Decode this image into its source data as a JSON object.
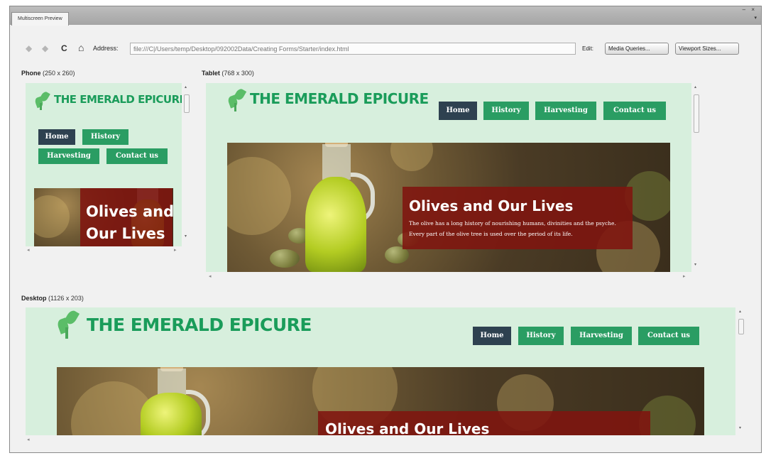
{
  "window": {
    "tab_title": "Multiscreen Preview",
    "controls": "– ×",
    "menu": "▾"
  },
  "toolbar": {
    "back_icon": "◆",
    "forward_icon": "◆",
    "reload_icon": "C",
    "home_icon": "⌂",
    "address_label": "Address:",
    "address_value": "file:///C|/Users/temp/Desktop/092002Data/Creating Forms/Starter/index.html",
    "edit_label": "Edit:",
    "media_queries_label": "Media Queries...",
    "viewport_sizes_label": "Viewport Sizes..."
  },
  "viewports": {
    "phone": {
      "name": "Phone",
      "size": "(250 x 260)"
    },
    "tablet": {
      "name": "Tablet",
      "size": "(768 x 300)"
    },
    "desktop": {
      "name": "Desktop",
      "size": "(1126 x 203)"
    }
  },
  "site": {
    "brand": "THE EMERALD EPICURE",
    "nav": {
      "home": "Home",
      "history": "History",
      "harvesting": "Harvesting",
      "contact": "Contact us"
    },
    "hero_title": "Olives and Our Lives",
    "hero_title_line1": "Olives and",
    "hero_title_line2": "Our Lives",
    "hero_text": "The olive has a long history of nourishing humans, divinities and the psyche. Every part of the olive tree is used over the period of its life."
  },
  "colors": {
    "page_bg": "#d7efdd",
    "brand": "#1a9c5a",
    "nav_button": "#2a9d63",
    "nav_active": "#2e4150",
    "overlay": "#80140f"
  },
  "icons": {
    "scroll_up": "▴",
    "scroll_down": "▾",
    "scroll_left": "◂",
    "scroll_right": "▸"
  }
}
